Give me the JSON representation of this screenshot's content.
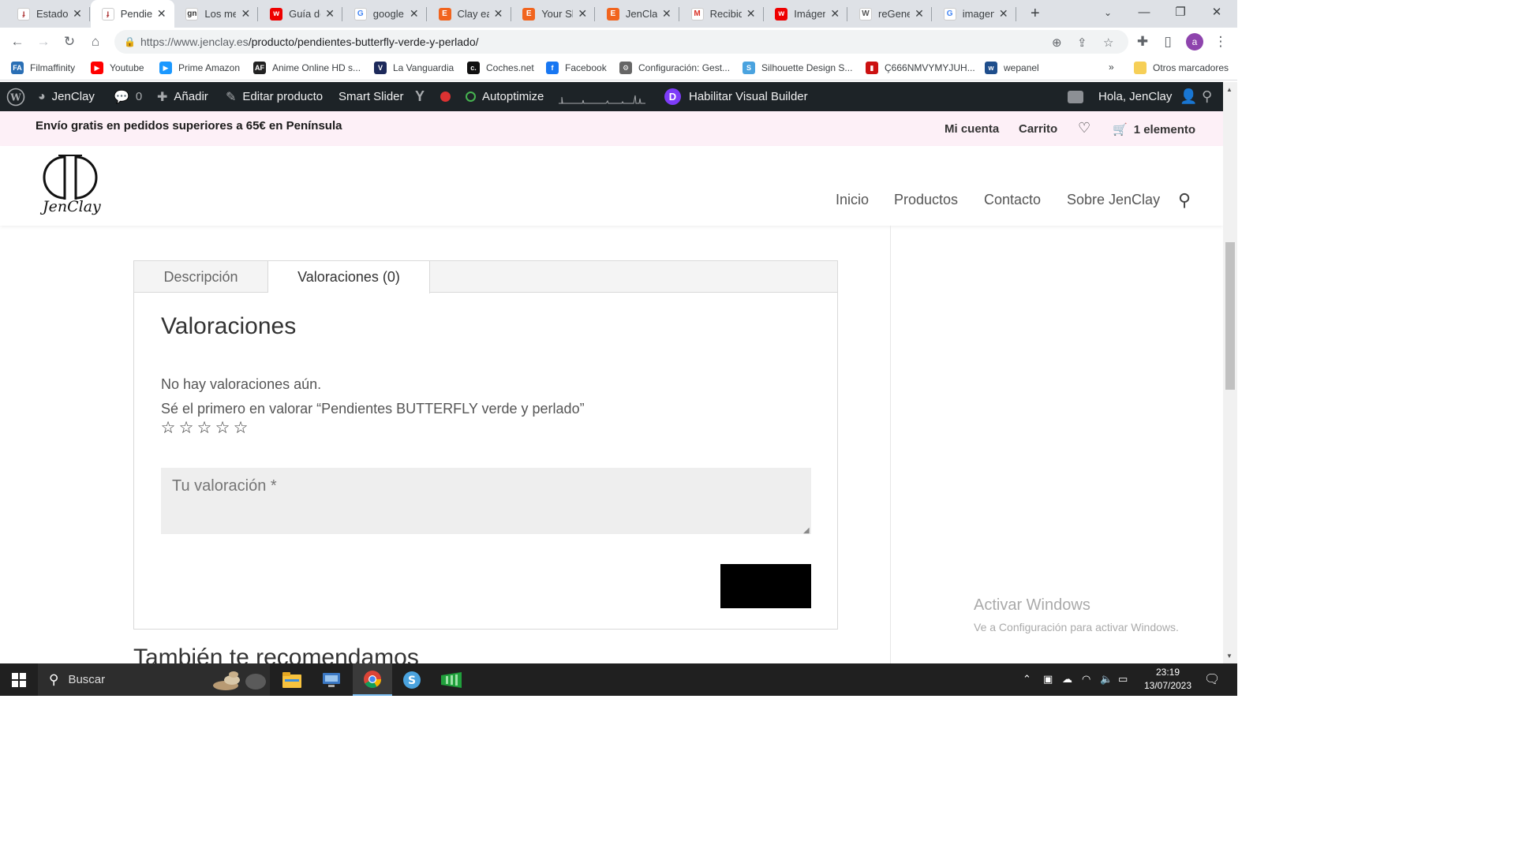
{
  "browser": {
    "tabs": [
      {
        "title": "Estado",
        "icon": "jenclay-favicon-icon",
        "active": false
      },
      {
        "title": "Pendien",
        "icon": "jenclay-favicon-icon",
        "active": true
      },
      {
        "title": "Los mej",
        "icon": "gn-favicon-icon",
        "active": false
      },
      {
        "title": "Guía de",
        "icon": "red-w-favicon-icon",
        "active": false
      },
      {
        "title": "google",
        "icon": "google-favicon-icon",
        "active": false
      },
      {
        "title": "Clay ea",
        "icon": "etsy-favicon-icon",
        "active": false
      },
      {
        "title": "Your Sh",
        "icon": "etsy-favicon-icon",
        "active": false
      },
      {
        "title": "JenClay",
        "icon": "etsy-favicon-icon",
        "active": false
      },
      {
        "title": "Recibid",
        "icon": "gmail-favicon-icon",
        "active": false
      },
      {
        "title": "Imágen",
        "icon": "red-w-favicon-icon",
        "active": false
      },
      {
        "title": "reGene",
        "icon": "wordpress-favicon-icon",
        "active": false
      },
      {
        "title": "imagen",
        "icon": "google-favicon-icon",
        "active": false
      }
    ],
    "new_tab": "+",
    "url_host": "https://www.jenclay.es",
    "url_path": "/producto/pendientes-butterfly-verde-y-perlado/",
    "profile_initial": "a",
    "bookmarks": [
      {
        "label": "Filmaffinity",
        "color": "#2a6fb5",
        "glyph": "FA"
      },
      {
        "label": "Youtube",
        "color": "#ff0000",
        "glyph": "▶"
      },
      {
        "label": "Prime Amazon",
        "color": "#1a98ff",
        "glyph": "▶"
      },
      {
        "label": "Anime Online HD s...",
        "color": "#222222",
        "glyph": "AF"
      },
      {
        "label": "La Vanguardia",
        "color": "#1d2a5b",
        "glyph": "V"
      },
      {
        "label": "Coches.net",
        "color": "#111111",
        "glyph": "c."
      },
      {
        "label": "Facebook",
        "color": "#1877f2",
        "glyph": "f"
      },
      {
        "label": "Configuración: Gest...",
        "color": "#666666",
        "glyph": "⚙"
      },
      {
        "label": "Silhouette Design S...",
        "color": "#4aa3df",
        "glyph": "S"
      },
      {
        "label": "Ç666NMVYMYJUH...",
        "color": "#cc1111",
        "glyph": "▮"
      },
      {
        "label": "wepanel",
        "color": "#1f4e8c",
        "glyph": "w"
      }
    ],
    "more_bookmarks": "»",
    "other_bookmarks": "Otros marcadores"
  },
  "wp_admin_bar": {
    "site": "JenClay",
    "comments": "0",
    "add_new": "Añadir",
    "edit": "Editar producto",
    "slider": "Smart Slider",
    "autoptimize": "Autoptimize",
    "visual_builder": "Habilitar Visual Builder",
    "greeting": "Hola, JenClay"
  },
  "site": {
    "promo": "Envío gratis en pedidos superiores a 65€ en Península",
    "account": "Mi cuenta",
    "cart": "Carrito",
    "cart_items": "1 elemento",
    "logo_text": "JenClay",
    "nav": [
      "Inicio",
      "Productos",
      "Contacto",
      "Sobre JenClay"
    ]
  },
  "product_tabs": {
    "tab_description": "Descripción",
    "tab_reviews": "Valoraciones (0)",
    "reviews_title": "Valoraciones",
    "no_reviews": "No hay valoraciones aún.",
    "be_first": "Sé el primero en valorar “Pendientes BUTTERFLY verde y perlado”",
    "rating_max": 5,
    "review_placeholder": "Tu valoración *"
  },
  "related_title": "También te recomendamos",
  "windows_watermark": {
    "line1": "Activar Windows",
    "line2": "Ve a Configuración para activar Windows."
  },
  "taskbar": {
    "search_placeholder": "Buscar",
    "time": "23:19",
    "date": "13/07/2023"
  }
}
